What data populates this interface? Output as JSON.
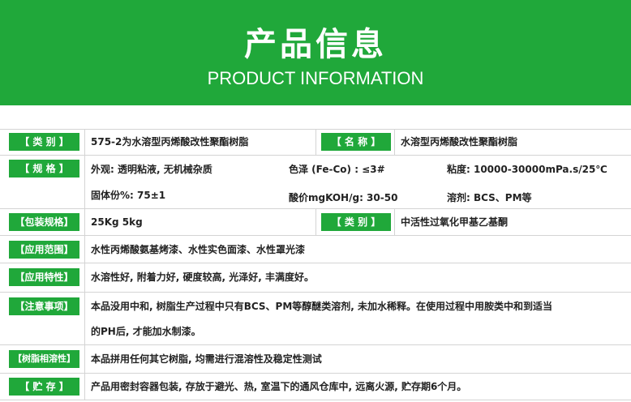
{
  "header": {
    "title": "产品信息",
    "subtitle": "PRODUCT INFORMATION"
  },
  "rows": {
    "category": {
      "label": "【 类    别 】",
      "value": "575-2为水溶型丙烯酸改性聚酯树脂"
    },
    "name": {
      "label": "【 名    称 】",
      "value": "水溶型丙烯酸改性聚酯树脂"
    },
    "specs": {
      "label": "【 规    格 】",
      "appearance": "外观: 透明粘液, 无机械杂质",
      "color": "色泽 (Fe-Co) : ≤3#",
      "viscosity": "粘度: 10000-30000mPa.s/25℃",
      "solids": "固体份%: 75±1",
      "acid_value": "酸价mgKOH/g:   30-50",
      "solvent": "溶剂: BCS、PM等"
    },
    "packaging": {
      "label": "【包装规格】",
      "value": "25Kg   5kg"
    },
    "category2": {
      "label": "【 类    别 】",
      "value": "中活性过氧化甲基乙基酮"
    },
    "application": {
      "label": "【应用范围】",
      "value": "水性丙烯酸氨基烤漆、水性实色面漆、水性罩光漆"
    },
    "features": {
      "label": "【应用特性】",
      "value": "水溶性好, 附着力好, 硬度较高, 光泽好, 丰满度好。"
    },
    "notes": {
      "label": "【注意事项】",
      "line1": "本品没用中和, 树脂生产过程中只有BCS、PM等醇醚类溶剂, 未加水稀释。在使用过程中用胺类中和到适当",
      "line2": "的PH后, 才能加水制漆。"
    },
    "compatibility": {
      "label": "【树脂相溶性】",
      "value": "本品拼用任何其它树脂, 均需进行混溶性及稳定性测试"
    },
    "storage": {
      "label": "【 贮    存 】",
      "value": "产品用密封容器包装, 存放于避光、热, 室温下的通风仓库中, 远离火源, 贮存期6个月。"
    }
  },
  "colors": {
    "accent": "#20a83a",
    "border": "#d4d4d4"
  }
}
